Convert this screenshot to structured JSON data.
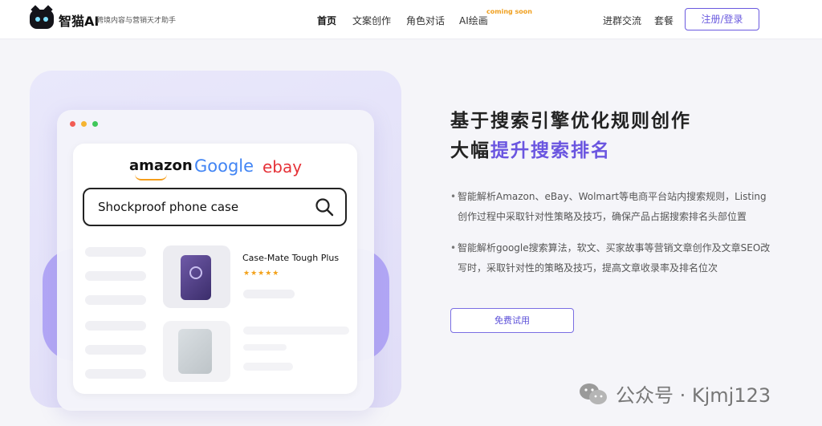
{
  "colors": {
    "accent": "#6a55e0",
    "coming_soon": "#f0a020",
    "amazon_orange": "#f59e1c",
    "google_blue": "#4285f4",
    "ebay_red": "#e53238",
    "star": "#f3a21b"
  },
  "header": {
    "logo_title": "智猫AI",
    "logo_subtitle": "跨境内容与营销天才助手",
    "nav": [
      "首页",
      "文案创作",
      "角色对话",
      "AI绘画"
    ],
    "coming_soon": "coming soon",
    "links": [
      "进群交流",
      "套餐"
    ],
    "login_label": "注册/登录"
  },
  "illustration": {
    "brands": [
      "amazon",
      "Google",
      "ebay"
    ],
    "search_query": "Shockproof phone case",
    "product_title": "Case-Mate Tough Plus",
    "stars": "★★★★★",
    "icons": [
      "search-icon",
      "phone-icon"
    ]
  },
  "hero": {
    "headline_line1": "基于搜索引擎优化规则创作",
    "headline_line2_plain": "大幅",
    "headline_line2_accent": "提升搜索排名",
    "bullets": [
      "智能解析Amazon、eBay、Wolmart等电商平台站内搜索规则，Listing创作过程中采取针对性策略及技巧，确保产品占据搜索排名头部位置",
      "智能解析google搜索算法，软文、买家故事等营销文章创作及文章SEO改写时，采取针对性的策略及技巧，提高文章收录率及排名位次"
    ],
    "bullet_symbol": "•",
    "try_label": "免费试用"
  },
  "watermark": {
    "text": "公众号 · Kjmj123"
  }
}
